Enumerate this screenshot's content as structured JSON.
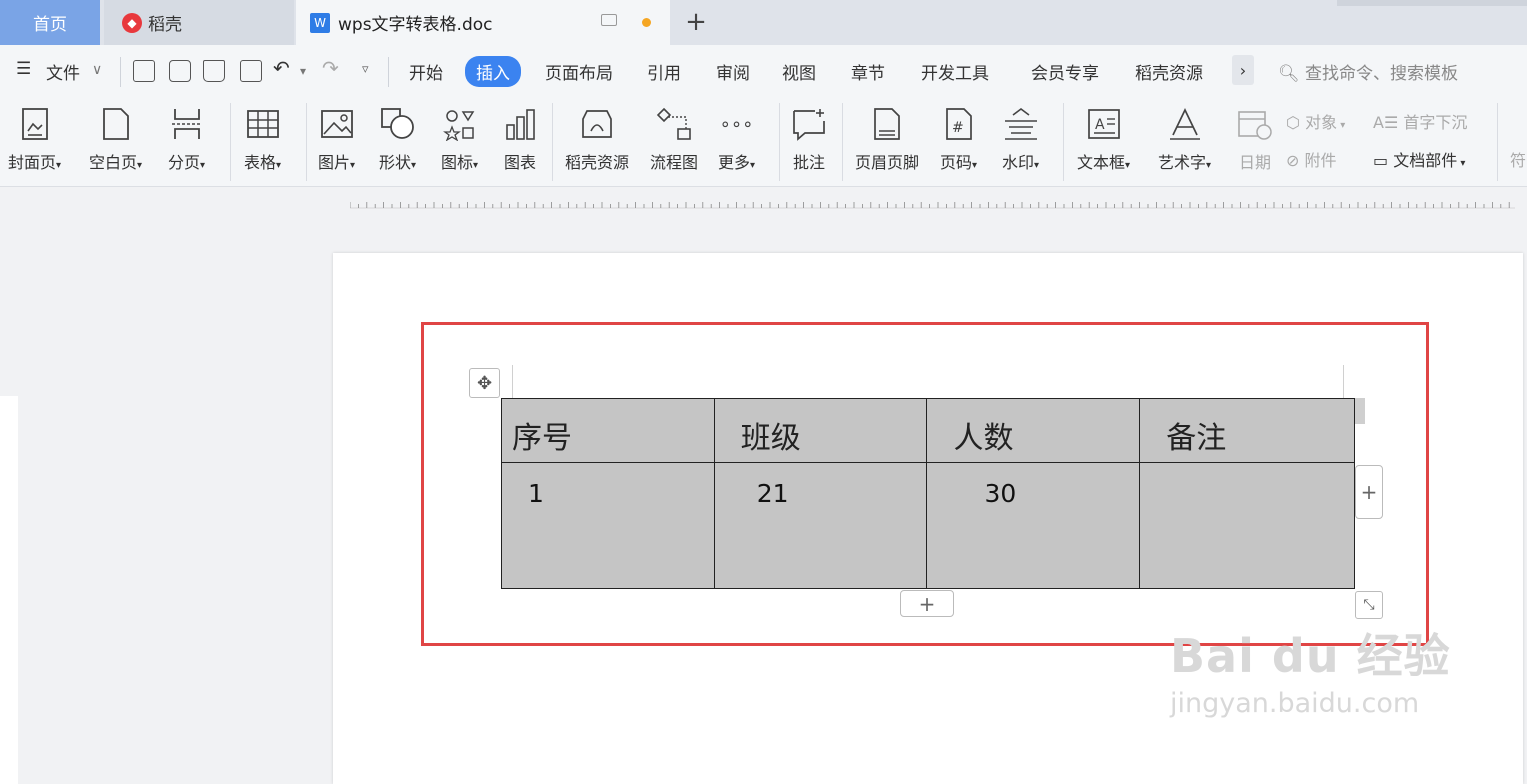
{
  "tabs": {
    "home": "首页",
    "docer": "稻壳",
    "document": "wps文字转表格.doc",
    "add": "+"
  },
  "menu": {
    "file": "文件",
    "items": [
      "开始",
      "插入",
      "页面布局",
      "引用",
      "审阅",
      "视图",
      "章节",
      "开发工具",
      "会员专享",
      "稻壳资源"
    ],
    "active": "插入",
    "more": "›",
    "search_placeholder": "查找命令、搜索模板"
  },
  "ribbon": {
    "buttons": [
      {
        "label": "封面页",
        "icon": "cover-page-icon"
      },
      {
        "label": "空白页",
        "icon": "blank-page-icon"
      },
      {
        "label": "分页",
        "icon": "page-break-icon"
      },
      {
        "label": "表格",
        "icon": "table-icon"
      },
      {
        "label": "图片",
        "icon": "picture-icon"
      },
      {
        "label": "形状",
        "icon": "shape-icon"
      },
      {
        "label": "图标",
        "icon": "icons-icon"
      },
      {
        "label": "图表",
        "icon": "chart-icon"
      },
      {
        "label": "稻壳资源",
        "icon": "docer-resource-icon"
      },
      {
        "label": "流程图",
        "icon": "flowchart-icon"
      },
      {
        "label": "更多",
        "icon": "more-icon"
      },
      {
        "label": "批注",
        "icon": "comment-icon"
      },
      {
        "label": "页眉页脚",
        "icon": "header-footer-icon"
      },
      {
        "label": "页码",
        "icon": "page-number-icon"
      },
      {
        "label": "水印",
        "icon": "watermark-icon"
      },
      {
        "label": "文本框",
        "icon": "textbox-icon"
      },
      {
        "label": "艺术字",
        "icon": "wordart-icon"
      },
      {
        "label": "日期",
        "icon": "date-icon"
      }
    ],
    "small": {
      "object": "对象",
      "attachment": "附件",
      "drop_cap": "首字下沉",
      "doc_parts": "文档部件",
      "symbol": "符"
    }
  },
  "table": {
    "headers": [
      "序号",
      "班级",
      "人数",
      "备注"
    ],
    "rows": [
      [
        "1",
        "21",
        "30",
        ""
      ]
    ]
  },
  "watermark": {
    "line1": "Bai du 经验",
    "line2": "jingyan.baidu.com"
  },
  "colors": {
    "accent": "#3b83f0",
    "highlight": "#e04545",
    "table_bg": "#c5c5c5"
  }
}
